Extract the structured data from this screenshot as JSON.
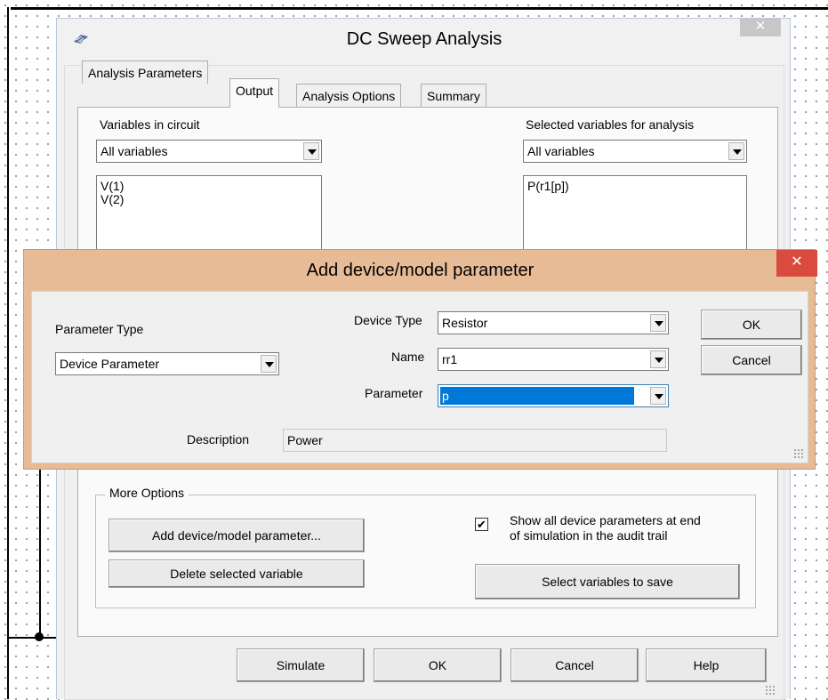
{
  "dc_dialog": {
    "title": "DC Sweep Analysis",
    "close_glyph": "✕",
    "tabs": [
      {
        "label": "Analysis Parameters"
      },
      {
        "label": "Output"
      },
      {
        "label": "Analysis Options"
      },
      {
        "label": "Summary"
      }
    ],
    "active_tab": "Output",
    "variables_in_circuit": {
      "label": "Variables in circuit",
      "filter_value": "All variables",
      "items": [
        "V(1)",
        "V(2)"
      ]
    },
    "selected_variables": {
      "label": "Selected variables for analysis",
      "filter_value": "All variables",
      "items": [
        "P(r1[p])"
      ]
    },
    "more_options": {
      "legend": "More Options",
      "add_param_button": "Add device/model parameter...",
      "delete_button": "Delete selected variable",
      "show_all_checkbox_checked": true,
      "show_all_label_line1": "Show all device parameters at end",
      "show_all_label_line2": "of simulation in the audit trail",
      "select_save_button": "Select variables to save"
    },
    "buttons": {
      "simulate": "Simulate",
      "ok": "OK",
      "cancel": "Cancel",
      "help": "Help"
    }
  },
  "add_param_dialog": {
    "title": "Add device/model parameter",
    "close_glyph": "✕",
    "parameter_type_label": "Parameter Type",
    "parameter_type_value": "Device Parameter",
    "device_type_label": "Device Type",
    "device_type_value": "Resistor",
    "name_label": "Name",
    "name_value": "rr1",
    "parameter_label": "Parameter",
    "parameter_value": "p",
    "description_label": "Description",
    "description_value": "Power",
    "ok_button": "OK",
    "cancel_button": "Cancel"
  },
  "colors": {
    "title_bar_active": "#e8bb97",
    "close_button_red": "#d94a3f",
    "selection_blue": "#0078d7"
  }
}
